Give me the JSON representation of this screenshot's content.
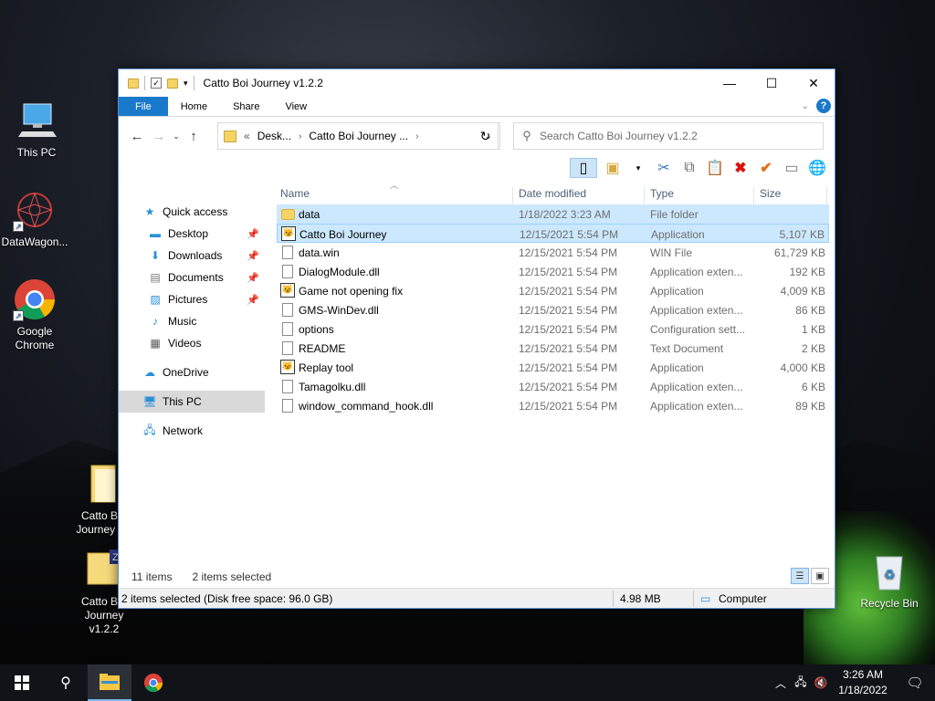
{
  "desktop": {
    "icons": [
      {
        "label": "This PC"
      },
      {
        "label": "DataWagon..."
      },
      {
        "label": "Google Chrome"
      },
      {
        "label": "Catto B... Journey v..."
      },
      {
        "label": "Catto B... Journey v1.2.2"
      },
      {
        "label": "Recycle Bin"
      }
    ]
  },
  "window": {
    "title": "Catto Boi Journey v1.2.2",
    "controls": {
      "minimize": "—",
      "maximize": "☐",
      "close": "✕"
    },
    "ribbon_tabs": [
      "File",
      "Home",
      "Share",
      "View"
    ],
    "help": "?",
    "address": {
      "prefix": "«",
      "segments": [
        "Desk...",
        "Catto Boi Journey ..."
      ]
    },
    "search": {
      "placeholder": "Search Catto Boi Journey v1.2.2"
    },
    "nav_pane": {
      "quick_access": "Quick access",
      "items": [
        {
          "label": "Desktop",
          "pinned": true
        },
        {
          "label": "Downloads",
          "pinned": true
        },
        {
          "label": "Documents",
          "pinned": true
        },
        {
          "label": "Pictures",
          "pinned": true
        },
        {
          "label": "Music",
          "pinned": false
        },
        {
          "label": "Videos",
          "pinned": false
        }
      ],
      "onedrive": "OneDrive",
      "this_pc": "This PC",
      "network": "Network"
    },
    "columns": {
      "name": "Name",
      "date": "Date modified",
      "type": "Type",
      "size": "Size"
    },
    "files": [
      {
        "name": "data",
        "date": "1/18/2022 3:23 AM",
        "type": "File folder",
        "size": "",
        "icon": "folder",
        "selected": true
      },
      {
        "name": "Catto Boi Journey",
        "date": "12/15/2021 5:54 PM",
        "type": "Application",
        "size": "5,107 KB",
        "icon": "app",
        "selected": true
      },
      {
        "name": "data.win",
        "date": "12/15/2021 5:54 PM",
        "type": "WIN File",
        "size": "61,729 KB",
        "icon": "doc",
        "selected": false
      },
      {
        "name": "DialogModule.dll",
        "date": "12/15/2021 5:54 PM",
        "type": "Application exten...",
        "size": "192 KB",
        "icon": "doc",
        "selected": false
      },
      {
        "name": "Game not opening fix",
        "date": "12/15/2021 5:54 PM",
        "type": "Application",
        "size": "4,009 KB",
        "icon": "app",
        "selected": false
      },
      {
        "name": "GMS-WinDev.dll",
        "date": "12/15/2021 5:54 PM",
        "type": "Application exten...",
        "size": "86 KB",
        "icon": "doc",
        "selected": false
      },
      {
        "name": "options",
        "date": "12/15/2021 5:54 PM",
        "type": "Configuration sett...",
        "size": "1 KB",
        "icon": "doc",
        "selected": false
      },
      {
        "name": "README",
        "date": "12/15/2021 5:54 PM",
        "type": "Text Document",
        "size": "2 KB",
        "icon": "doc",
        "selected": false
      },
      {
        "name": "Replay tool",
        "date": "12/15/2021 5:54 PM",
        "type": "Application",
        "size": "4,000 KB",
        "icon": "app",
        "selected": false
      },
      {
        "name": "Tamagolku.dll",
        "date": "12/15/2021 5:54 PM",
        "type": "Application exten...",
        "size": "6 KB",
        "icon": "doc",
        "selected": false
      },
      {
        "name": "window_command_hook.dll",
        "date": "12/15/2021 5:54 PM",
        "type": "Application exten...",
        "size": "89 KB",
        "icon": "doc",
        "selected": false
      }
    ],
    "status": {
      "count": "11 items",
      "selected": "2 items selected"
    },
    "details": {
      "summary": "2 items selected (Disk free space: 96.0 GB)",
      "size": "4.98 MB",
      "location": "Computer"
    }
  },
  "taskbar": {
    "time": "3:26 AM",
    "date": "1/18/2022"
  }
}
